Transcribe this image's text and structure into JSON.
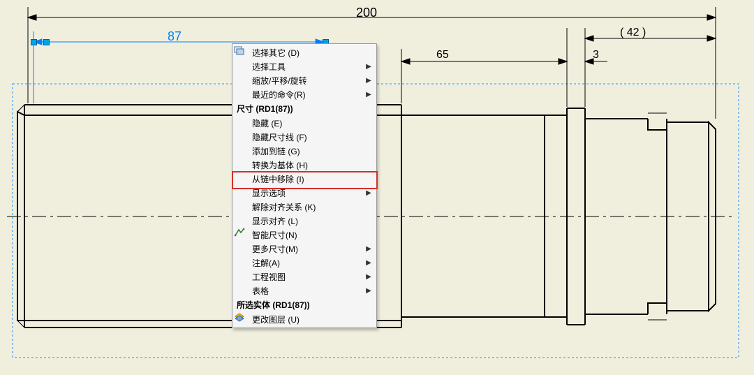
{
  "dims": {
    "d200": "200",
    "d87": "87",
    "d65": "65",
    "d42": "( 42 )",
    "d3": "3"
  },
  "menu": {
    "section1": [
      {
        "label": "选择其它 (D)",
        "icon": "select-other",
        "sub": false
      },
      {
        "label": "选择工具",
        "icon": "",
        "sub": true
      },
      {
        "label": "缩放/平移/旋转",
        "icon": "",
        "sub": true
      },
      {
        "label": "最近的命令(R)",
        "icon": "",
        "sub": true
      }
    ],
    "header1": "尺寸 (RD1(87))",
    "section2": [
      {
        "label": "隐藏 (E)",
        "icon": "",
        "sub": false
      },
      {
        "label": "隐藏尺寸线 (F)",
        "icon": "",
        "sub": false
      },
      {
        "label": "添加到链 (G)",
        "icon": "",
        "sub": false
      },
      {
        "label": "转换为基体 (H)",
        "icon": "",
        "sub": false,
        "hl": true
      },
      {
        "label": "从链中移除 (I)",
        "icon": "",
        "sub": false
      },
      {
        "label": "显示选项",
        "icon": "",
        "sub": true
      },
      {
        "label": "解除对齐关系 (K)",
        "icon": "",
        "sub": false
      },
      {
        "label": "显示对齐 (L)",
        "icon": "",
        "sub": false
      },
      {
        "label": "智能尺寸(N)",
        "icon": "smart-dim",
        "sub": false
      },
      {
        "label": "更多尺寸(M)",
        "icon": "",
        "sub": true
      },
      {
        "label": "注解(A)",
        "icon": "",
        "sub": true
      },
      {
        "label": "工程视图",
        "icon": "",
        "sub": true
      },
      {
        "label": "表格",
        "icon": "",
        "sub": true
      }
    ],
    "header2": "所选实体 (RD1(87))",
    "section3": [
      {
        "label": "更改图层 (U)",
        "icon": "layer",
        "sub": false
      }
    ]
  }
}
